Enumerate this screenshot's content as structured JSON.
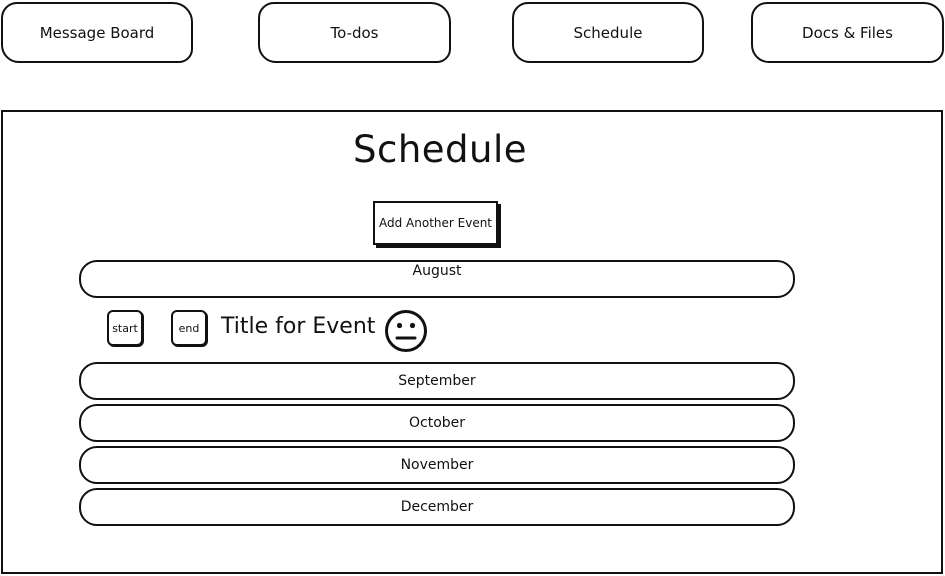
{
  "nav": {
    "tabs": [
      {
        "label": "Message Board"
      },
      {
        "label": "To-dos"
      },
      {
        "label": "Schedule"
      },
      {
        "label": "Docs & Files"
      }
    ]
  },
  "main": {
    "title": "Schedule",
    "add_button_label": "Add Another Event",
    "months": [
      {
        "label": "August"
      },
      {
        "label": "September"
      },
      {
        "label": "October"
      },
      {
        "label": "November"
      },
      {
        "label": "December"
      }
    ],
    "event": {
      "start_label": "start",
      "end_label": "end",
      "title": "Title for Event",
      "icon": "neutral-face-icon"
    }
  }
}
